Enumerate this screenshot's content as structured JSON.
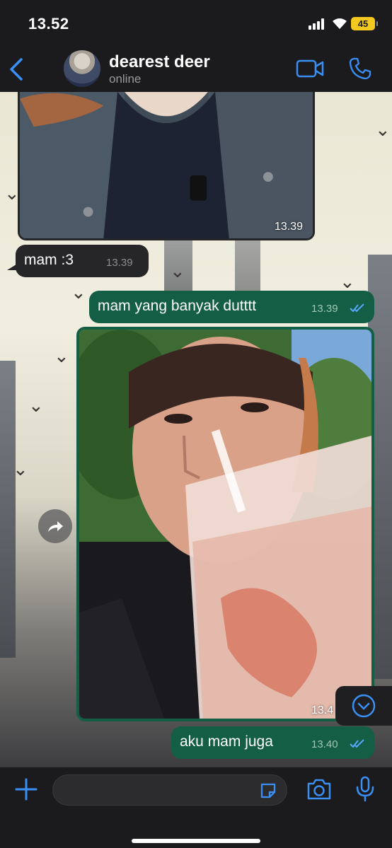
{
  "status_bar": {
    "time": "13.52",
    "battery": "45"
  },
  "header": {
    "contact_name": "dearest deer",
    "contact_status": "online"
  },
  "messages": [
    {
      "type": "photo",
      "direction": "incoming",
      "time": "13.39"
    },
    {
      "type": "text",
      "direction": "incoming",
      "text": "mam :3",
      "time": "13.39"
    },
    {
      "type": "text",
      "direction": "outgoing",
      "text": "mam yang banyak dutttt",
      "time": "13.39",
      "read": true
    },
    {
      "type": "photo",
      "direction": "outgoing",
      "time": "13.4"
    },
    {
      "type": "text",
      "direction": "outgoing",
      "text": "aku mam juga",
      "time": "13.40",
      "read": true
    }
  ],
  "composer": {
    "placeholder": ""
  },
  "icons": {
    "back": "chevron-left-icon",
    "video": "video-camera-icon",
    "call": "phone-icon",
    "forward": "forward-arrow-icon",
    "scroll_down": "chevron-down-circle-icon",
    "plus": "plus-icon",
    "sticker": "sticker-icon",
    "camera": "camera-icon",
    "mic": "microphone-icon"
  },
  "colors": {
    "accent": "#3a8ff5",
    "outgoing_bubble": "#135e44",
    "incoming_bubble": "#262628",
    "read_ticks": "#58a8ff",
    "battery": "#f3c81f"
  }
}
